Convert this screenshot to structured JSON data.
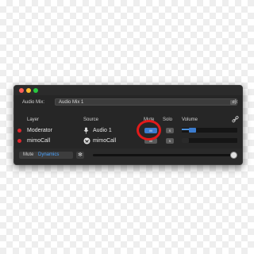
{
  "window": {
    "traffic_colors": [
      "#ff5f57",
      "#febc2e",
      "#28c840"
    ]
  },
  "mix": {
    "label": "Audio Mix:",
    "selected": "Audio Mix 1"
  },
  "headers": {
    "layer": "Layer",
    "source": "Source",
    "mute": "Mute",
    "solo": "Solo",
    "volume": "Volume"
  },
  "rows": [
    {
      "name": "Moderator",
      "source": "Audio 1",
      "source_icon": "microphone-icon",
      "mute_label": "M",
      "muted": true,
      "solo_label": "S",
      "volume_level": 0.15
    },
    {
      "name": "mimoCall",
      "source": "mimoCall",
      "source_icon": "mimocall-icon",
      "mute_label": "M",
      "muted": false,
      "solo_label": "S",
      "volume_level": 0.0
    }
  ],
  "bottom": {
    "tabs": [
      "Mute",
      "Dynamics"
    ],
    "active_tab": "Dynamics",
    "master_level": 1.0
  },
  "colors": {
    "accent": "#4a8fd9",
    "active_tab_text": "#4aa3ff",
    "live_dot": "#e0282e",
    "highlight": "#e11a1a",
    "mute_on": "#3b7ccf",
    "mute_off": "#5a5a5a"
  }
}
